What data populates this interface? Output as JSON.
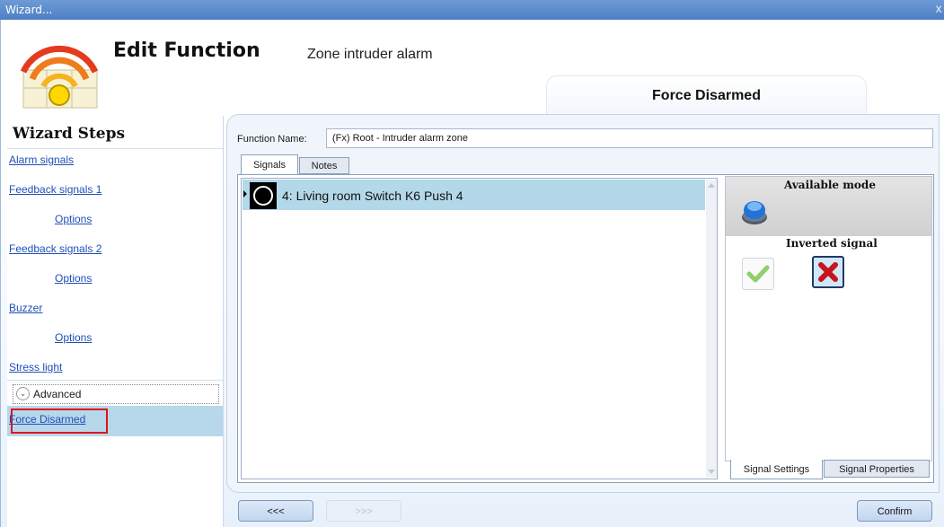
{
  "window": {
    "title": "Wizard...",
    "close_glyph": "x"
  },
  "header": {
    "title": "Edit Function",
    "subtitle": "Zone intruder alarm",
    "step_tab": "Force Disarmed",
    "icon": "alarm-wifi-icon"
  },
  "sidebar": {
    "title": "Wizard Steps",
    "items": [
      {
        "label": "Alarm signals"
      },
      {
        "label": "Feedback signals 1"
      },
      {
        "label": "Options"
      },
      {
        "label": "Feedback signals 2"
      },
      {
        "label": "Options"
      },
      {
        "label": "Buzzer"
      },
      {
        "label": "Options"
      },
      {
        "label": "Stress light"
      }
    ],
    "advanced_label": "Advanced",
    "selected_item": "Force Disarmed"
  },
  "form": {
    "function_name_label": "Function Name:",
    "function_name_value": "(Fx) Root - Intruder alarm zone"
  },
  "tabs": {
    "signals": "Signals",
    "notes": "Notes"
  },
  "signals": [
    {
      "label": "4: Living room Switch K6 Push 4",
      "icon": "push-button-icon"
    }
  ],
  "settings": {
    "available_mode_title": "Available mode",
    "inverted_signal_title": "Inverted signal",
    "mode_icon": "blue-push-button-icon",
    "inverted_options": [
      "check-icon",
      "cross-icon"
    ]
  },
  "bottom_tabs": {
    "signal_settings": "Signal Settings",
    "signal_properties": "Signal Properties"
  },
  "nav": {
    "prev": "<<<",
    "next": ">>>",
    "confirm": "Confirm"
  },
  "colors": {
    "titlebar": "#5a89cb",
    "selection": "#b3d8e9",
    "highlight_border": "#e0141e",
    "link": "#1f4fb5"
  }
}
